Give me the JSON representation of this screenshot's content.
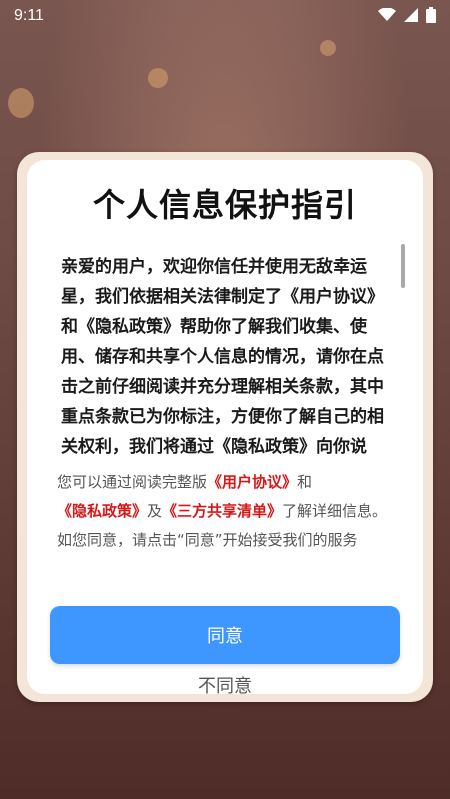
{
  "status": {
    "time": "9:11",
    "icons": [
      "wifi-icon",
      "signal-icon",
      "battery-icon"
    ]
  },
  "dialog": {
    "title": "个人信息保护指引",
    "body": "亲爱的用户，欢迎你信任并使用无敌幸运星，我们依据相关法律制定了《用户协议》和《隐私政策》帮助你了解我们收集、使用、储存和共享个人信息的情况，请你在点击之前仔细阅读并充分理解相关条款，其中重点条款已为你标注，方便你了解自己的相关权利，我们将通过《隐私政策》向你说明：",
    "notice": {
      "prefix": "您可以通过阅读完整版",
      "link_user_agreement": "《用户协议》",
      "and": "和",
      "link_privacy_policy": "《隐私政策》",
      "and2": "及",
      "link_third_party": "《三方共享清单》",
      "suffix": "了解详细信息。如您同意，请点击“同意”开始接受我们的服务"
    },
    "agree_label": "同意",
    "disagree_label": "不同意"
  },
  "colors": {
    "primary_button": "#3d97ff",
    "link": "#d81818",
    "frame": "#f3e6d8"
  }
}
